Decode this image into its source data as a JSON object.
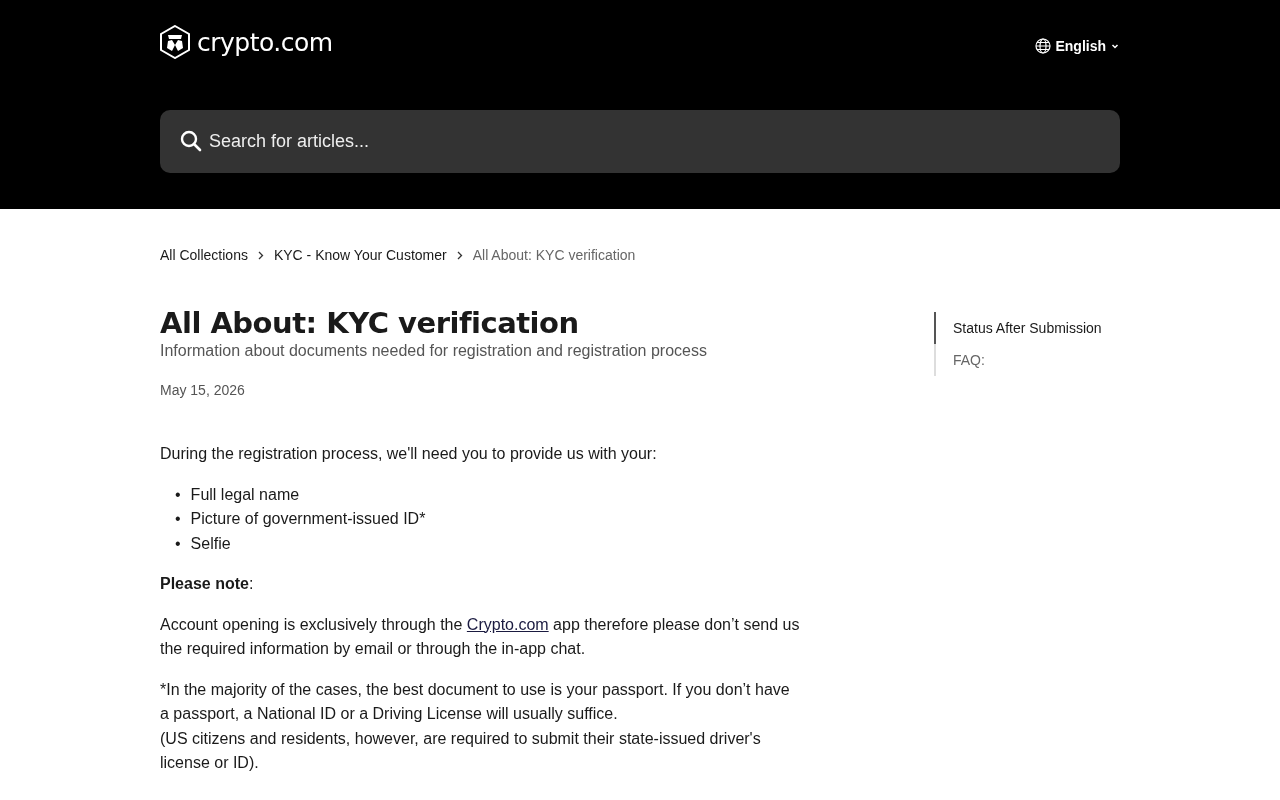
{
  "header": {
    "logo_text": "crypto.com",
    "language": "English",
    "search": {
      "placeholder": "Search for articles..."
    }
  },
  "breadcrumb": [
    {
      "label": "All Collections",
      "current": false
    },
    {
      "label": "KYC - Know Your Customer",
      "current": false
    },
    {
      "label": "All About: KYC verification",
      "current": true
    }
  ],
  "article": {
    "title": "All About: KYC verification",
    "subtitle": "Information about documents needed for registration and registration process",
    "date": "May 15, 2026",
    "blocks": [
      {
        "kind": "paragraph",
        "text": "During the registration process, we'll need you to provide us with your:"
      },
      {
        "kind": "list",
        "marker": "•",
        "items": [
          "Full legal name",
          "Picture of government-issued ID*",
          "Selfie"
        ]
      },
      {
        "kind": "paragraph",
        "text": "**Please note**:"
      },
      {
        "kind": "link-paragraph",
        "before": "Account opening is exclusively through the ",
        "link": "Crypto.com",
        "after": " app therefore please don’t send us the required information by email or through the in-app chat."
      },
      {
        "kind": "lines",
        "lines": [
          "*In the majority of the cases, the best document to use is your passport.  If you don’t have a passport, a National ID or a Driving License will usually suffice.",
          "(US citizens and residents, however, are required to submit their state-issued driver's license or ID)."
        ]
      }
    ]
  },
  "toc": [
    {
      "label": "Status After Submission",
      "selected": true
    },
    {
      "label": "FAQ:",
      "selected": false
    }
  ]
}
